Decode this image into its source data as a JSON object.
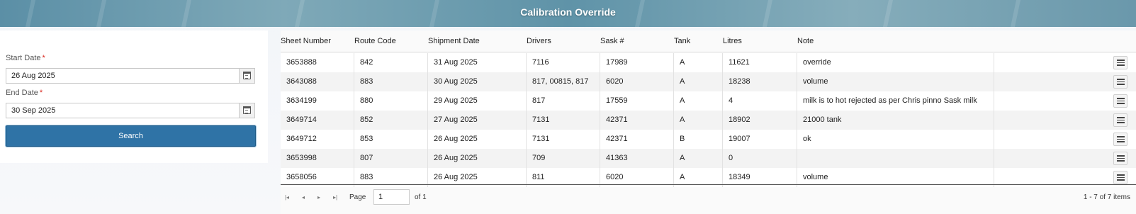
{
  "header": {
    "title": "Calibration Override"
  },
  "filters": {
    "start_label": "Start Date",
    "start_value": "26 Aug 2025",
    "end_label": "End Date",
    "end_value": "30 Sep 2025",
    "required_mark": "*",
    "search_label": "Search"
  },
  "grid": {
    "columns": [
      "Sheet Number",
      "Route Code",
      "Shipment Date",
      "Drivers",
      "Sask #",
      "Tank",
      "Litres",
      "Note"
    ],
    "rows": [
      [
        "3653888",
        "842",
        "31 Aug 2025",
        "7116",
        "17989",
        "A",
        "11621",
        "override"
      ],
      [
        "3643088",
        "883",
        "30 Aug 2025",
        "817, 00815, 817",
        "6020",
        "A",
        "18238",
        "volume"
      ],
      [
        "3634199",
        "880",
        "29 Aug 2025",
        "817",
        "17559",
        "A",
        "4",
        "milk is to hot rejected as per Chris pinno Sask milk"
      ],
      [
        "3649714",
        "852",
        "27 Aug 2025",
        "7131",
        "42371",
        "A",
        "18902",
        "21000 tank"
      ],
      [
        "3649712",
        "853",
        "26 Aug 2025",
        "7131",
        "42371",
        "B",
        "19007",
        "ok"
      ],
      [
        "3653998",
        "807",
        "26 Aug 2025",
        "709",
        "41363",
        "A",
        "0",
        ""
      ],
      [
        "3658056",
        "883",
        "26 Aug 2025",
        "811",
        "6020",
        "A",
        "18349",
        "volume"
      ]
    ]
  },
  "pager": {
    "page_label": "Page",
    "page_value": "1",
    "of_label": "of 1",
    "items_info": "1 - 7 of 7 items"
  },
  "colors": {
    "primary_button": "#2f73a6",
    "required": "#d9281f"
  }
}
